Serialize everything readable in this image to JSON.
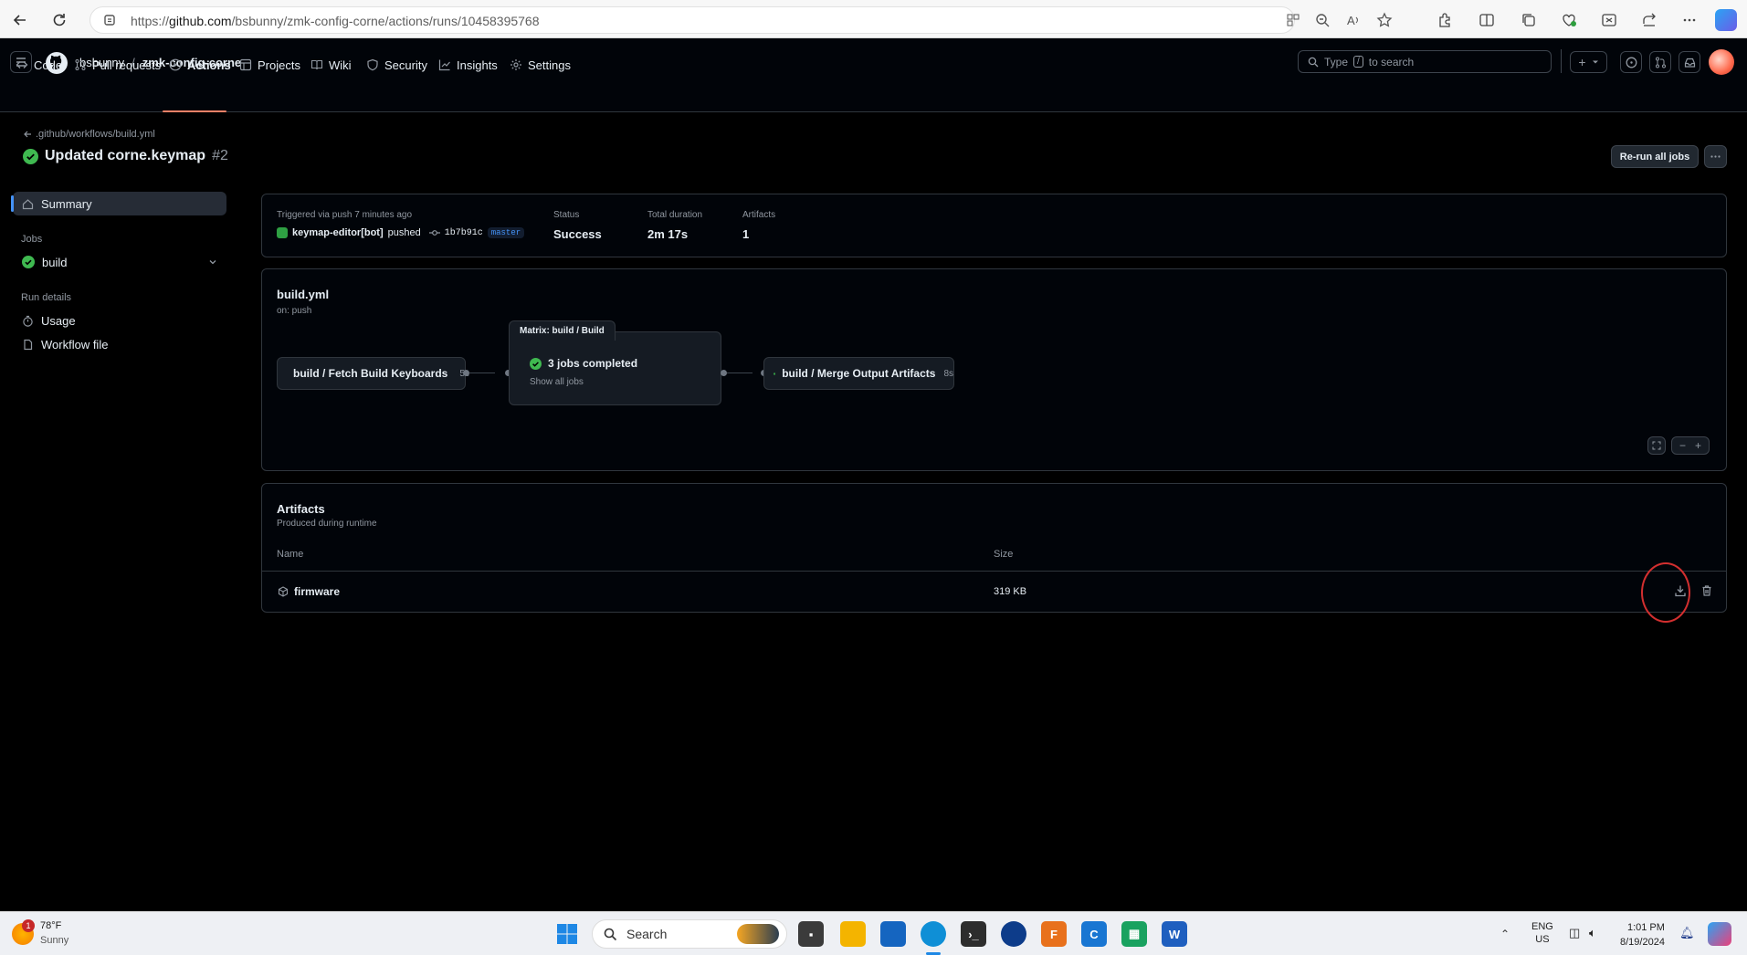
{
  "browser": {
    "url_prefix": "https://",
    "url_domain": "github.com",
    "url_path": "/bsbunny/zmk-config-corne/actions/runs/10458395768"
  },
  "header": {
    "owner": "bsbunny",
    "separator": "/",
    "repo": "zmk-config-corne",
    "search_placeholder_pre": "Type",
    "search_key": "/",
    "search_placeholder_post": "to search",
    "plus_label": "+"
  },
  "tabs": [
    {
      "label": "Code",
      "icon": "code-icon"
    },
    {
      "label": "Pull requests",
      "icon": "pull-request-icon"
    },
    {
      "label": "Actions",
      "icon": "play-icon"
    },
    {
      "label": "Projects",
      "icon": "table-icon"
    },
    {
      "label": "Wiki",
      "icon": "book-icon"
    },
    {
      "label": "Security",
      "icon": "shield-icon"
    },
    {
      "label": "Insights",
      "icon": "graph-icon"
    },
    {
      "label": "Settings",
      "icon": "gear-icon"
    }
  ],
  "run": {
    "back_link": ".github/workflows/build.yml",
    "title": "Updated corne.keymap",
    "number": "#2",
    "rerun_label": "Re-run all jobs"
  },
  "sidebar": {
    "summary": "Summary",
    "jobs_heading": "Jobs",
    "job_build": "build",
    "run_details_heading": "Run details",
    "usage": "Usage",
    "workflow_file": "Workflow file"
  },
  "summary": {
    "trigger": "Triggered via push 7 minutes ago",
    "actor": "keymap-editor[bot]",
    "action": "pushed",
    "commit": "1b7b91c",
    "branch": "master",
    "status_label": "Status",
    "status_value": "Success",
    "duration_label": "Total duration",
    "duration_value": "2m 17s",
    "artifacts_label": "Artifacts",
    "artifacts_value": "1"
  },
  "workflow": {
    "name": "build.yml",
    "trigger": "on: push",
    "job1": {
      "label": "build / Fetch Build Keyboards",
      "duration": "5s"
    },
    "matrix": {
      "title": "Matrix: build / Build",
      "label": "3 jobs completed",
      "link": "Show all jobs"
    },
    "job3": {
      "label": "build / Merge Output Artifacts",
      "duration": "8s"
    }
  },
  "artifacts": {
    "title": "Artifacts",
    "subtitle": "Produced during runtime",
    "col_name": "Name",
    "col_size": "Size",
    "rows": [
      {
        "name": "firmware",
        "size": "319 KB"
      }
    ]
  },
  "taskbar": {
    "temperature": "78°F",
    "weather": "Sunny",
    "weather_badge": "1",
    "search": "Search",
    "lang": "ENG",
    "region": "US",
    "time": "1:01 PM",
    "date": "8/19/2024"
  },
  "colors": {
    "success": "#3fb950",
    "accent_underline": "#f78166",
    "annotation": "#d32f2f",
    "branch_text": "#4493f8"
  }
}
